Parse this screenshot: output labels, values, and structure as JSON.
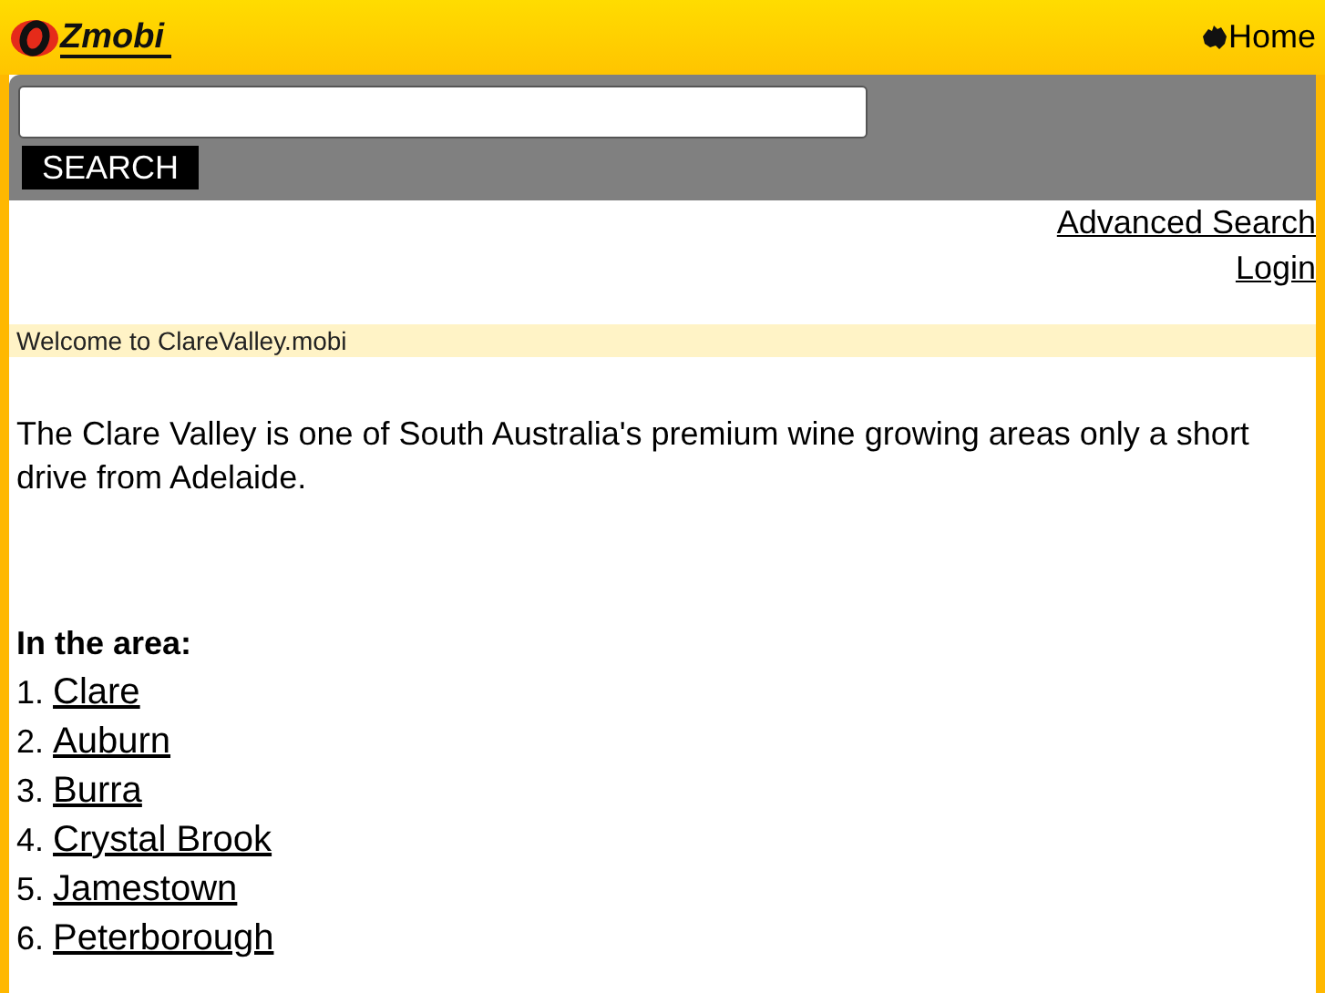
{
  "header": {
    "logo_text": "Zmobi",
    "home_link": "Home"
  },
  "search": {
    "button": "SEARCH"
  },
  "links": [
    "Advanced Search",
    "Login"
  ],
  "welcome": "Welcome to ClareValley.mobi",
  "intro": "The Clare Valley is one of South Australia's premium wine growing areas only a short drive from Adelaide.",
  "area": {
    "heading": "In the area:",
    "items": [
      {
        "number": "1.",
        "name": "Clare"
      },
      {
        "number": "2.",
        "name": "Auburn"
      },
      {
        "number": "3.",
        "name": "Burra"
      },
      {
        "number": "4.",
        "name": "Crystal Brook"
      },
      {
        "number": "5.",
        "name": "Jamestown"
      },
      {
        "number": "6.",
        "name": "Peterborough"
      }
    ]
  }
}
